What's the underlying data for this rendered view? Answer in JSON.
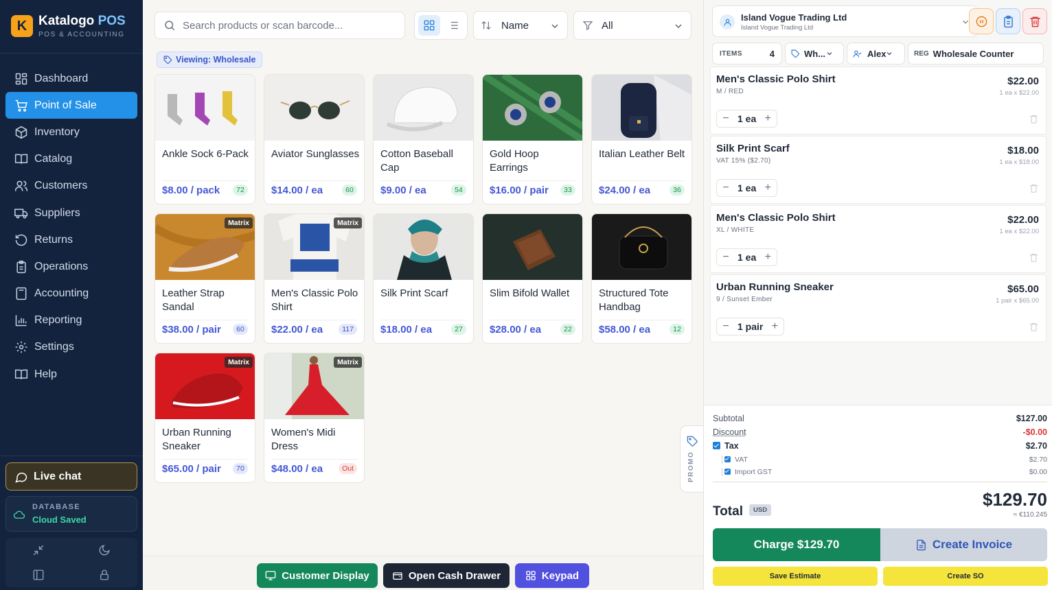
{
  "brand": {
    "name": "Katalogo",
    "name_accent": "POS",
    "subtitle": "POS & ACCOUNTING",
    "logo_letter": "K"
  },
  "nav": [
    {
      "label": "Dashboard",
      "icon": "grid-icon"
    },
    {
      "label": "Point of Sale",
      "icon": "cart-icon",
      "active": true
    },
    {
      "label": "Inventory",
      "icon": "box-icon"
    },
    {
      "label": "Catalog",
      "icon": "book-icon"
    },
    {
      "label": "Customers",
      "icon": "users-icon"
    },
    {
      "label": "Suppliers",
      "icon": "truck-icon"
    },
    {
      "label": "Returns",
      "icon": "return-icon"
    },
    {
      "label": "Operations",
      "icon": "clipboard-icon"
    },
    {
      "label": "Accounting",
      "icon": "calculator-icon"
    },
    {
      "label": "Reporting",
      "icon": "bar-chart-icon"
    },
    {
      "label": "Settings",
      "icon": "gear-icon"
    },
    {
      "label": "Help",
      "icon": "book-open-icon"
    }
  ],
  "livechat": {
    "label": "Live chat"
  },
  "database": {
    "label": "DATABASE",
    "status": "Cloud Saved"
  },
  "search": {
    "placeholder": "Search products or scan barcode..."
  },
  "sort": {
    "label": "Name"
  },
  "filter": {
    "label": "All"
  },
  "viewing": {
    "label": "Viewing: Wholesale"
  },
  "products": [
    {
      "name": "Ankle Sock 6-Pack",
      "price": "$8.00 / pack",
      "stock": "72",
      "stock_kind": "g",
      "matrix": ""
    },
    {
      "name": "Aviator Sunglasses",
      "price": "$14.00 / ea",
      "stock": "60",
      "stock_kind": "g",
      "matrix": ""
    },
    {
      "name": "Cotton Baseball Cap",
      "price": "$9.00 / ea",
      "stock": "54",
      "stock_kind": "g",
      "matrix": ""
    },
    {
      "name": "Gold Hoop Earrings",
      "price": "$16.00 / pair",
      "stock": "33",
      "stock_kind": "g",
      "matrix": ""
    },
    {
      "name": "Italian Leather Belt",
      "price": "$24.00 / ea",
      "stock": "36",
      "stock_kind": "g",
      "matrix": ""
    },
    {
      "name": "Leather Strap Sandal",
      "price": "$38.00 / pair",
      "stock": "60",
      "stock_kind": "b",
      "matrix": "Matrix"
    },
    {
      "name": "Men's Classic Polo Shirt",
      "price": "$22.00 / ea",
      "stock": "117",
      "stock_kind": "b",
      "matrix": "Matrix"
    },
    {
      "name": "Silk Print Scarf",
      "price": "$18.00 / ea",
      "stock": "27",
      "stock_kind": "g",
      "matrix": ""
    },
    {
      "name": "Slim Bifold Wallet",
      "price": "$28.00 / ea",
      "stock": "22",
      "stock_kind": "g",
      "matrix": ""
    },
    {
      "name": "Structured Tote Handbag",
      "price": "$58.00 / ea",
      "stock": "12",
      "stock_kind": "g",
      "matrix": ""
    },
    {
      "name": "Urban Running Sneaker",
      "price": "$65.00 / pair",
      "stock": "70",
      "stock_kind": "b",
      "matrix": "Matrix"
    },
    {
      "name": "Women's Midi Dress",
      "price": "$48.00 / ea",
      "stock": "Out",
      "stock_kind": "r",
      "matrix": "Matrix"
    }
  ],
  "promo": {
    "label": "PROMO"
  },
  "bottom": {
    "customer_display": "Customer Display",
    "open_drawer": "Open Cash Drawer",
    "keypad": "Keypad"
  },
  "customer": {
    "name": "Island Vogue Trading Ltd",
    "sub": "Island Vogue Trading Ltd"
  },
  "meta": {
    "items_label": "ITEMS",
    "items_count": "4",
    "tier": "Wh...",
    "user": "Alex",
    "reg_label": "REG",
    "register": "Wholesale Counter"
  },
  "lines": [
    {
      "name": "Men's Classic Polo Shirt",
      "variant": "M / RED",
      "price": "$22.00",
      "unit": "1 ea x $22.00",
      "qty": "1 ea"
    },
    {
      "name": "Silk Print Scarf",
      "variant": "VAT 15% ($2.70)",
      "price": "$18.00",
      "unit": "1 ea x $18.00",
      "qty": "1 ea"
    },
    {
      "name": "Men's Classic Polo Shirt",
      "variant": "XL / WHITE",
      "price": "$22.00",
      "unit": "1 ea x $22.00",
      "qty": "1 ea"
    },
    {
      "name": "Urban Running Sneaker",
      "variant": "9 / Sunset Ember",
      "price": "$65.00",
      "unit": "1 pair x $65.00",
      "qty": "1 pair"
    }
  ],
  "totals": {
    "subtotal_label": "Subtotal",
    "subtotal": "$127.00",
    "discount_label": "Discount",
    "discount": "-$0.00",
    "tax_label": "Tax",
    "tax": "$2.70",
    "vat_label": "VAT",
    "vat": "$2.70",
    "gst_label": "Import GST",
    "gst": "$0.00",
    "total_label": "Total",
    "currency": "USD",
    "total": "$129.70",
    "total_alt": "≈ €110.245"
  },
  "actions": {
    "charge": "Charge $129.70",
    "invoice": "Create Invoice",
    "estimate": "Save Estimate",
    "so": "Create SO"
  }
}
